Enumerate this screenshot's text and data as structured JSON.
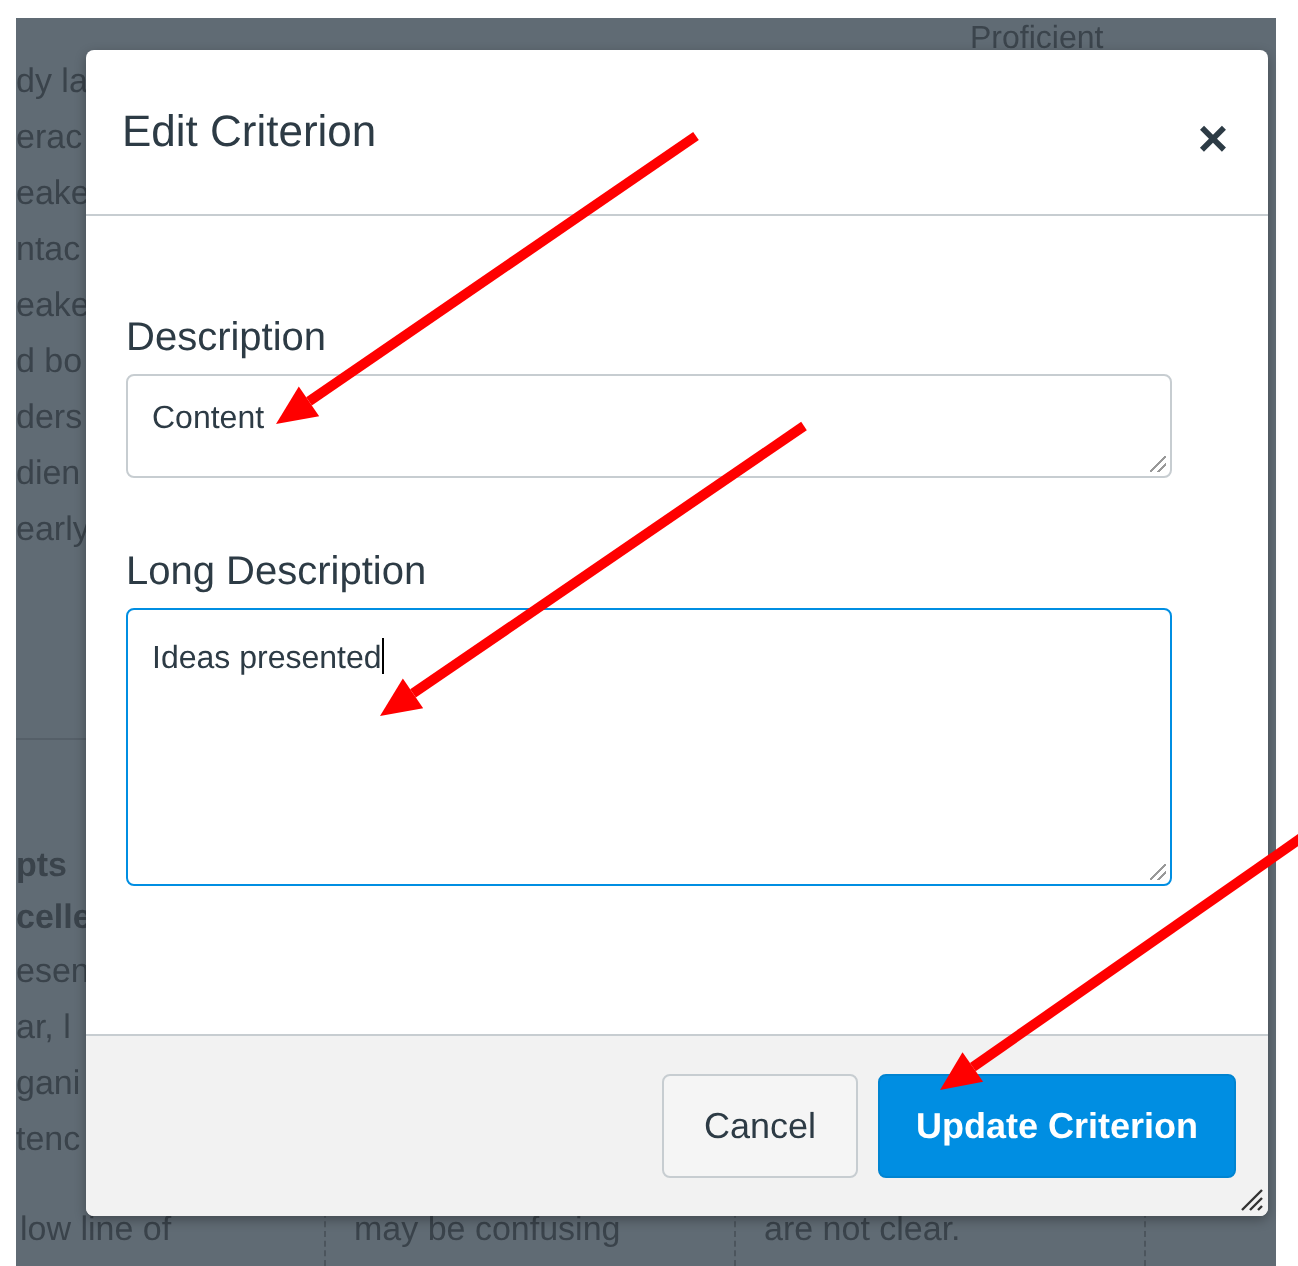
{
  "background": {
    "header": "Proficient",
    "left_column_top": [
      "dy la",
      "erac",
      "eake",
      "ntac",
      "eake",
      "d bo",
      "ders",
      "dien",
      "early"
    ],
    "left_column_bottom": [
      "pts",
      "celle",
      "esen",
      "ar, l",
      "gani",
      "tenc"
    ],
    "bottom_row": [
      "low line of",
      "may be confusing",
      "are not clear."
    ]
  },
  "dialog": {
    "title": "Edit Criterion",
    "close": "×",
    "fields": [
      {
        "label": "Description",
        "kind": "line",
        "value": "Content",
        "focused": false
      },
      {
        "label": "Long Description",
        "kind": "area",
        "value": "Ideas presented",
        "focused": true
      }
    ],
    "buttons": [
      {
        "label": "Cancel",
        "primary": false
      },
      {
        "label": "Update Criterion",
        "primary": true
      }
    ]
  },
  "annotations": [
    {
      "kind": "arrow"
    },
    {
      "kind": "arrow"
    },
    {
      "kind": "arrow"
    }
  ]
}
